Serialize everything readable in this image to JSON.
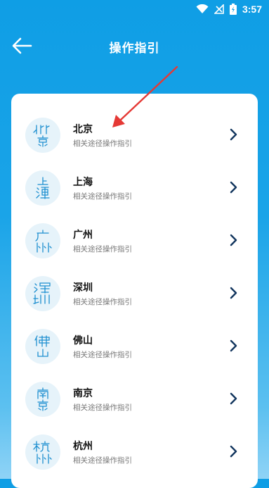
{
  "status_bar": {
    "time": "3:57",
    "icons": [
      "wifi-icon",
      "no-signal-icon",
      "battery-charging-icon"
    ]
  },
  "header": {
    "title": "操作指引",
    "back_icon": "arrow-left-icon"
  },
  "colors": {
    "background_top": "#0f9ee5",
    "background_bottom": "#8fd3f6",
    "avatar_bg": "#e6f3fa",
    "seal_ink": "#1e8fd0",
    "chevron": "#12355e",
    "annotation_arrow": "#e53935"
  },
  "cities": [
    {
      "name": "北京",
      "subtitle": "相关途径操作指引",
      "icon": "beijing-seal-icon"
    },
    {
      "name": "上海",
      "subtitle": "相关途径操作指引",
      "icon": "shanghai-seal-icon"
    },
    {
      "name": "广州",
      "subtitle": "相关途径操作指引",
      "icon": "guangzhou-seal-icon"
    },
    {
      "name": "深圳",
      "subtitle": "相关途径操作指引",
      "icon": "shenzhen-seal-icon"
    },
    {
      "name": "佛山",
      "subtitle": "相关途径操作指引",
      "icon": "foshan-seal-icon"
    },
    {
      "name": "南京",
      "subtitle": "相关途径操作指引",
      "icon": "nanjing-seal-icon"
    },
    {
      "name": "杭州",
      "subtitle": "相关途径操作指引",
      "icon": "hangzhou-seal-icon"
    }
  ]
}
